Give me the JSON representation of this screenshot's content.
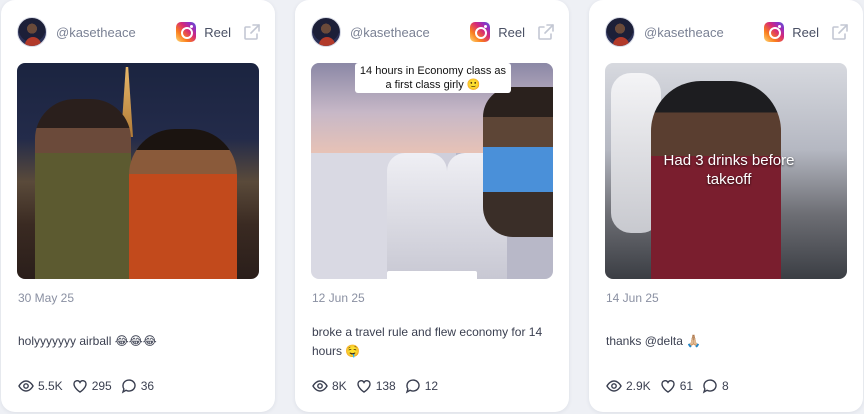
{
  "colors": {
    "background": "#eef0f5",
    "card": "#ffffff",
    "muted_text": "#7a8194",
    "body_text": "#3a3f50"
  },
  "cards": [
    {
      "handle": "@kasetheace",
      "platform_icon": "instagram-icon",
      "type": "Reel",
      "media_caption": "",
      "date": "30 May 25",
      "text": "holyyyyyyy airball 😂😂😂",
      "views": "5.5K",
      "likes": "295",
      "comments": "36"
    },
    {
      "handle": "@kasetheace",
      "platform_icon": "instagram-icon",
      "type": "Reel",
      "media_caption": "14 hours in Economy class as a first class girly 🙂",
      "date": "12 Jun 25",
      "text": "broke a travel rule and flew economy for 14 hours 🤤",
      "views": "8K",
      "likes": "138",
      "comments": "12"
    },
    {
      "handle": "@kasetheace",
      "platform_icon": "instagram-icon",
      "type": "Reel",
      "media_caption": "Had 3 drinks before takeoff",
      "date": "14 Jun 25",
      "text": "thanks @delta 🙏🏼",
      "views": "2.9K",
      "likes": "61",
      "comments": "8"
    }
  ]
}
